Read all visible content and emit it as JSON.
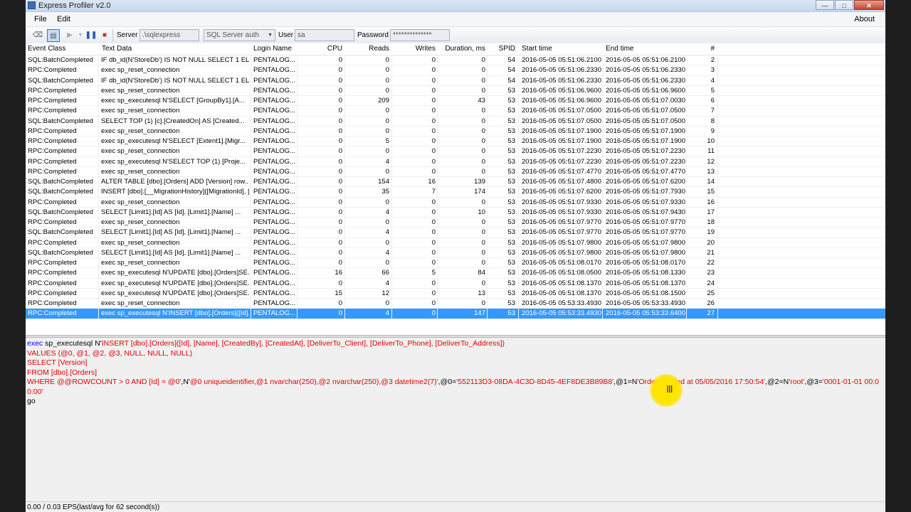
{
  "window": {
    "title": "Express Profiler v2.0"
  },
  "menu": {
    "file": "File",
    "edit": "Edit",
    "about": "About"
  },
  "toolbar": {
    "server_label": "Server",
    "server_value": ".\\sqlexpress",
    "auth_value": "SQL Server auth",
    "user_label": "User",
    "user_value": "sa",
    "password_label": "Password",
    "password_value": "**************"
  },
  "columns": {
    "event_class": "Event Class",
    "text_data": "Text Data",
    "login_name": "Login Name",
    "cpu": "CPU",
    "reads": "Reads",
    "writes": "Writes",
    "duration": "Duration, ms",
    "spid": "SPID",
    "start_time": "Start time",
    "end_time": "End time",
    "num": "#"
  },
  "rows": [
    {
      "ev": "SQL:BatchCompleted",
      "td": "IF db_id(N'StoreDb') IS NOT NULL SELECT 1 EL...",
      "ln": "PENTALOG...",
      "cpu": "0",
      "r": "0",
      "w": "0",
      "d": "0",
      "sp": "54",
      "st": "2016-05-05 05:51:06.2100",
      "et": "2016-05-05 05:51:06.2100",
      "n": "2"
    },
    {
      "ev": "RPC:Completed",
      "td": "exec sp_reset_connection",
      "ln": "PENTALOG...",
      "cpu": "0",
      "r": "0",
      "w": "0",
      "d": "0",
      "sp": "54",
      "st": "2016-05-05 05:51:06.2330",
      "et": "2016-05-05 05:51:06.2330",
      "n": "3"
    },
    {
      "ev": "SQL:BatchCompleted",
      "td": "IF db_id(N'StoreDb') IS NOT NULL SELECT 1 EL...",
      "ln": "PENTALOG...",
      "cpu": "0",
      "r": "0",
      "w": "0",
      "d": "0",
      "sp": "54",
      "st": "2016-05-05 05:51:06.2330",
      "et": "2016-05-05 05:51:06.2330",
      "n": "4"
    },
    {
      "ev": "RPC:Completed",
      "td": "exec sp_reset_connection",
      "ln": "PENTALOG...",
      "cpu": "0",
      "r": "0",
      "w": "0",
      "d": "0",
      "sp": "53",
      "st": "2016-05-05 05:51:06.9600",
      "et": "2016-05-05 05:51:06.9600",
      "n": "5"
    },
    {
      "ev": "RPC:Completed",
      "td": "exec sp_executesql N'SELECT     [GroupBy1].[A...",
      "ln": "PENTALOG...",
      "cpu": "0",
      "r": "209",
      "w": "0",
      "d": "43",
      "sp": "53",
      "st": "2016-05-05 05:51:06.9600",
      "et": "2016-05-05 05:51:07.0030",
      "n": "6"
    },
    {
      "ev": "RPC:Completed",
      "td": "exec sp_reset_connection",
      "ln": "PENTALOG...",
      "cpu": "0",
      "r": "0",
      "w": "0",
      "d": "0",
      "sp": "53",
      "st": "2016-05-05 05:51:07.0500",
      "et": "2016-05-05 05:51:07.0500",
      "n": "7"
    },
    {
      "ev": "SQL:BatchCompleted",
      "td": "SELECT TOP (1)     [c].[CreatedOn] AS [Created...",
      "ln": "PENTALOG...",
      "cpu": "0",
      "r": "0",
      "w": "0",
      "d": "0",
      "sp": "53",
      "st": "2016-05-05 05:51:07.0500",
      "et": "2016-05-05 05:51:07.0500",
      "n": "8"
    },
    {
      "ev": "RPC:Completed",
      "td": "exec sp_reset_connection",
      "ln": "PENTALOG...",
      "cpu": "0",
      "r": "0",
      "w": "0",
      "d": "0",
      "sp": "53",
      "st": "2016-05-05 05:51:07.1900",
      "et": "2016-05-05 05:51:07.1900",
      "n": "9"
    },
    {
      "ev": "RPC:Completed",
      "td": "exec sp_executesql N'SELECT     [Extent1].[Migr...",
      "ln": "PENTALOG...",
      "cpu": "0",
      "r": "5",
      "w": "0",
      "d": "0",
      "sp": "53",
      "st": "2016-05-05 05:51:07.1900",
      "et": "2016-05-05 05:51:07.1900",
      "n": "10"
    },
    {
      "ev": "RPC:Completed",
      "td": "exec sp_reset_connection",
      "ln": "PENTALOG...",
      "cpu": "0",
      "r": "0",
      "w": "0",
      "d": "0",
      "sp": "53",
      "st": "2016-05-05 05:51:07.2230",
      "et": "2016-05-05 05:51:07.2230",
      "n": "11"
    },
    {
      "ev": "RPC:Completed",
      "td": "exec sp_executesql N'SELECT TOP (1)     [Proje...",
      "ln": "PENTALOG...",
      "cpu": "0",
      "r": "4",
      "w": "0",
      "d": "0",
      "sp": "53",
      "st": "2016-05-05 05:51:07.2230",
      "et": "2016-05-05 05:51:07.2230",
      "n": "12"
    },
    {
      "ev": "RPC:Completed",
      "td": "exec sp_reset_connection",
      "ln": "PENTALOG...",
      "cpu": "0",
      "r": "0",
      "w": "0",
      "d": "0",
      "sp": "53",
      "st": "2016-05-05 05:51:07.4770",
      "et": "2016-05-05 05:51:07.4770",
      "n": "13"
    },
    {
      "ev": "SQL:BatchCompleted",
      "td": "ALTER TABLE [dbo].[Orders] ADD [Version] row...",
      "ln": "PENTALOG...",
      "cpu": "0",
      "r": "154",
      "w": "16",
      "d": "139",
      "sp": "53",
      "st": "2016-05-05 05:51:07.4800",
      "et": "2016-05-05 05:51:07.6200",
      "n": "14"
    },
    {
      "ev": "SQL:BatchCompleted",
      "td": "INSERT [dbo].[__MigrationHistory]([MigrationId], [...",
      "ln": "PENTALOG...",
      "cpu": "0",
      "r": "35",
      "w": "7",
      "d": "174",
      "sp": "53",
      "st": "2016-05-05 05:51:07.6200",
      "et": "2016-05-05 05:51:07.7930",
      "n": "15"
    },
    {
      "ev": "RPC:Completed",
      "td": "exec sp_reset_connection",
      "ln": "PENTALOG...",
      "cpu": "0",
      "r": "0",
      "w": "0",
      "d": "0",
      "sp": "53",
      "st": "2016-05-05 05:51:07.9330",
      "et": "2016-05-05 05:51:07.9330",
      "n": "16"
    },
    {
      "ev": "SQL:BatchCompleted",
      "td": "SELECT     [Limit1].[Id] AS [Id],     [Limit1].[Name] ...",
      "ln": "PENTALOG...",
      "cpu": "0",
      "r": "4",
      "w": "0",
      "d": "10",
      "sp": "53",
      "st": "2016-05-05 05:51:07.9330",
      "et": "2016-05-05 05:51:07.9430",
      "n": "17"
    },
    {
      "ev": "RPC:Completed",
      "td": "exec sp_reset_connection",
      "ln": "PENTALOG...",
      "cpu": "0",
      "r": "0",
      "w": "0",
      "d": "0",
      "sp": "53",
      "st": "2016-05-05 05:51:07.9770",
      "et": "2016-05-05 05:51:07.9770",
      "n": "18"
    },
    {
      "ev": "SQL:BatchCompleted",
      "td": "SELECT     [Limit1].[Id] AS [Id],     [Limit1].[Name] ...",
      "ln": "PENTALOG...",
      "cpu": "0",
      "r": "4",
      "w": "0",
      "d": "0",
      "sp": "53",
      "st": "2016-05-05 05:51:07.9770",
      "et": "2016-05-05 05:51:07.9770",
      "n": "19"
    },
    {
      "ev": "RPC:Completed",
      "td": "exec sp_reset_connection",
      "ln": "PENTALOG...",
      "cpu": "0",
      "r": "0",
      "w": "0",
      "d": "0",
      "sp": "53",
      "st": "2016-05-05 05:51:07.9800",
      "et": "2016-05-05 05:51:07.9800",
      "n": "20"
    },
    {
      "ev": "SQL:BatchCompleted",
      "td": "SELECT     [Limit1].[Id] AS [Id],     [Limit1].[Name] ...",
      "ln": "PENTALOG...",
      "cpu": "0",
      "r": "4",
      "w": "0",
      "d": "0",
      "sp": "53",
      "st": "2016-05-05 05:51:07.9800",
      "et": "2016-05-05 05:51:07.9800",
      "n": "21"
    },
    {
      "ev": "RPC:Completed",
      "td": "exec sp_reset_connection",
      "ln": "PENTALOG...",
      "cpu": "0",
      "r": "0",
      "w": "0",
      "d": "0",
      "sp": "53",
      "st": "2016-05-05 05:51:08.0170",
      "et": "2016-05-05 05:51:08.0170",
      "n": "22"
    },
    {
      "ev": "RPC:Completed",
      "td": "exec sp_executesql N'UPDATE [dbo].[Orders]SE...",
      "ln": "PENTALOG...",
      "cpu": "16",
      "r": "66",
      "w": "5",
      "d": "84",
      "sp": "53",
      "st": "2016-05-05 05:51:08.0500",
      "et": "2016-05-05 05:51:08.1330",
      "n": "23"
    },
    {
      "ev": "RPC:Completed",
      "td": "exec sp_executesql N'UPDATE [dbo].[Orders]SE...",
      "ln": "PENTALOG...",
      "cpu": "0",
      "r": "4",
      "w": "0",
      "d": "0",
      "sp": "53",
      "st": "2016-05-05 05:51:08.1370",
      "et": "2016-05-05 05:51:08.1370",
      "n": "24"
    },
    {
      "ev": "RPC:Completed",
      "td": "exec sp_executesql N'UPDATE [dbo].[Orders]SE...",
      "ln": "PENTALOG...",
      "cpu": "15",
      "r": "12",
      "w": "0",
      "d": "13",
      "sp": "53",
      "st": "2016-05-05 05:51:08.1370",
      "et": "2016-05-05 05:51:08.1500",
      "n": "25"
    },
    {
      "ev": "RPC:Completed",
      "td": "exec sp_reset_connection",
      "ln": "PENTALOG...",
      "cpu": "0",
      "r": "0",
      "w": "0",
      "d": "0",
      "sp": "53",
      "st": "2016-05-05 05:53:33.4930",
      "et": "2016-05-05 05:53:33.4930",
      "n": "26"
    },
    {
      "ev": "RPC:Completed",
      "td": "exec sp_executesql N'INSERT [dbo].[Orders]([Id]...",
      "ln": "PENTALOG...",
      "cpu": "0",
      "r": "4",
      "w": "0",
      "d": "147",
      "sp": "53",
      "st": "2016-05-05 05:53:33.4930",
      "et": "2016-05-05 05:53:33.6400",
      "n": "27",
      "selected": true
    }
  ],
  "sql": {
    "l1_kw": "exec",
    "l1_a": " sp_executesql N'",
    "l1_b": "INSERT [dbo].[Orders]([Id], [Name], [CreatedBy], [CreatedAt], [DeliverTo_Client], [DeliverTo_Phone], [DeliverTo_Address])",
    "l2": "VALUES (@0, @1, @2, @3, NULL, NULL, NULL)",
    "l3": "SELECT [Version]",
    "l4": "FROM [dbo].[Orders]",
    "l5_a": "WHERE @@ROWCOUNT > 0 AND [Id] = @0'",
    "l5_b": ",N'",
    "l5_c": "@0 uniqueidentifier,@1 nvarchar(250),@2 nvarchar(250),@3 datetime2(7)'",
    "l5_d": ",@0=",
    "l5_e": "'552113D3-08DA-4C3D-8D45-4EF8DE3B89B8'",
    "l5_f": ",@1=N",
    "l5_g": "'Order created at 05/05/2016 17:50:54'",
    "l5_h": ",@2=N",
    "l5_i": "'root'",
    "l5_j": ",@3=",
    "l5_k": "'0001-01-01 00:00:00'",
    "l6": "go"
  },
  "status": {
    "text": "0.00 / 0.03 EPS(last/avg for 62 second(s))"
  },
  "colors": {
    "selection": "#3399ff",
    "keyword": "#0000ff",
    "string": "#e00000"
  }
}
